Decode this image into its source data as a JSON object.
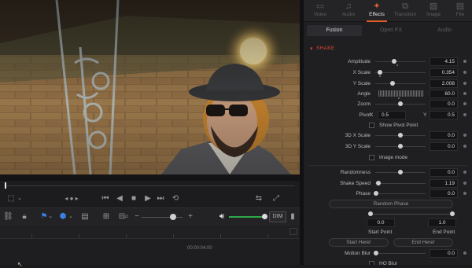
{
  "inspector": {
    "top_tabs": [
      {
        "label": "Video",
        "icon": "video-icon"
      },
      {
        "label": "Audio",
        "icon": "audio-icon"
      },
      {
        "label": "Effects",
        "icon": "effects-icon"
      },
      {
        "label": "Transition",
        "icon": "transition-icon"
      },
      {
        "label": "Image",
        "icon": "image-icon"
      },
      {
        "label": "File",
        "icon": "file-icon"
      }
    ],
    "sub_tabs": [
      "Fusion",
      "Open FX",
      "Audio"
    ],
    "section_title": "SHAKE",
    "params": {
      "amplitude": {
        "label": "Amplitude",
        "value": "4.15"
      },
      "x_scale": {
        "label": "X Scale",
        "value": "0.354"
      },
      "y_scale": {
        "label": "Y Scale",
        "value": "2.008"
      },
      "angle": {
        "label": "Angle",
        "value": "60.0"
      },
      "zoom": {
        "label": "Zoom",
        "value": "0.0"
      },
      "pivot": {
        "label": "Pivot",
        "x_label": "X",
        "x_value": "0.5",
        "y_label": "Y",
        "y_value": "0.5"
      },
      "show_pivot": {
        "label": "Show Pivot Point"
      },
      "x3d_scale": {
        "label": "3D X Scale",
        "value": "0.0"
      },
      "y3d_scale": {
        "label": "3D Y Scale",
        "value": "0.0"
      },
      "image_mode": {
        "label": "Image mode"
      },
      "randomness": {
        "label": "Randomness",
        "value": "0.0"
      },
      "shake_speed": {
        "label": "Shake Speed",
        "value": "1.19"
      },
      "phase": {
        "label": "Phase",
        "value": "0.0"
      },
      "random_phase_btn": "Random Phase",
      "start_point": {
        "label": "Start Point",
        "value": "0.0"
      },
      "end_point": {
        "label": "End Point",
        "value": "1.0"
      },
      "start_here_btn": "Start Here!",
      "end_here_btn": "End Here!",
      "motion_blur": {
        "label": "Motion Blur",
        "value": "0.0"
      },
      "hq_blur": {
        "label": "HQ Blur"
      }
    }
  },
  "timeline": {
    "timecode": "00:00:04:00",
    "dim_label": "DIM"
  },
  "colors": {
    "accent": "#e05a2a",
    "section_red": "#d9462d",
    "volume_green": "#2fa84a"
  }
}
